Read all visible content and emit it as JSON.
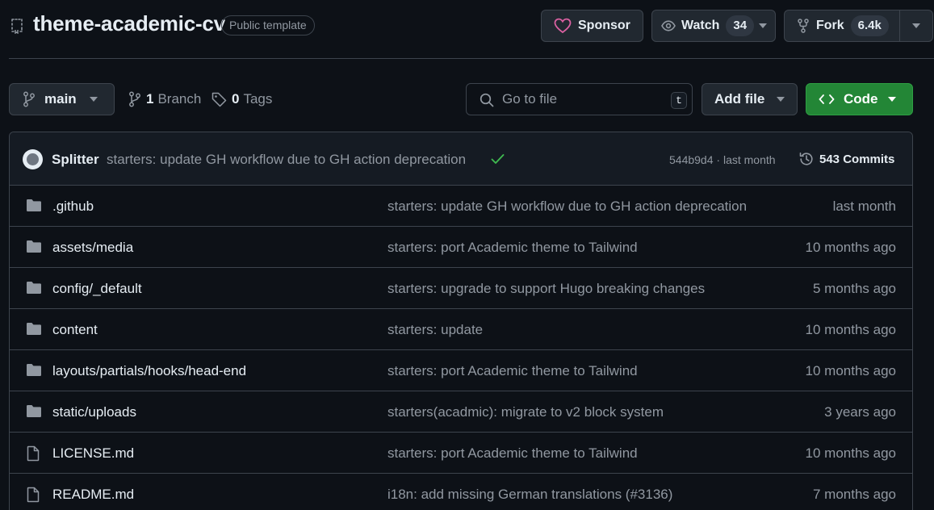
{
  "repo": {
    "name": "theme-academic-cv",
    "visibility": "Public template"
  },
  "actions": {
    "sponsor_label": "Sponsor",
    "watch_label": "Watch",
    "watch_count": "34",
    "fork_label": "Fork",
    "fork_count": "6.4k"
  },
  "toolbar": {
    "branch": "main",
    "branch_count": "1",
    "branch_label": "Branch",
    "tag_count": "0",
    "tag_label": "Tags",
    "goto_placeholder": "Go to file",
    "goto_shortcut": "t",
    "add_file_label": "Add file",
    "code_label": "Code"
  },
  "latest_commit": {
    "author": "Splitter",
    "message": "starters: update GH workflow due to GH action deprecation",
    "sha": "544b9d4",
    "separator": "·",
    "time": "last month",
    "commits_count": "543",
    "commits_label": "Commits"
  },
  "files": [
    {
      "type": "folder",
      "name": ".github",
      "commit": "starters: update GH workflow due to GH action deprecation",
      "age": "last month"
    },
    {
      "type": "folder",
      "name": "assets/media",
      "commit": "starters: port Academic theme to Tailwind",
      "age": "10 months ago"
    },
    {
      "type": "folder",
      "name": "config/_default",
      "commit": "starters: upgrade to support Hugo breaking changes",
      "age": "5 months ago"
    },
    {
      "type": "folder",
      "name": "content",
      "commit": "starters: update",
      "age": "10 months ago"
    },
    {
      "type": "folder",
      "name": "layouts/partials/hooks/head-end",
      "commit": "starters: port Academic theme to Tailwind",
      "age": "10 months ago"
    },
    {
      "type": "folder",
      "name": "static/uploads",
      "commit": "starters(acadmic): migrate to v2 block system",
      "age": "3 years ago"
    },
    {
      "type": "file",
      "name": "LICENSE.md",
      "commit": "starters: port Academic theme to Tailwind",
      "age": "10 months ago"
    },
    {
      "type": "file",
      "name": "README.md",
      "commit": "i18n: add missing German translations (#3136)",
      "age": "7 months ago"
    }
  ],
  "colors": {
    "background": "#0d1117",
    "border": "#3d444d",
    "muted_text": "#9198a1",
    "primary_button": "#238636",
    "sponsor_heart": "#db61a2",
    "success_check": "#3fb950",
    "folder_icon": "#9198a1"
  },
  "icons": {
    "repo": "repo-template-icon",
    "sponsor": "heart-icon",
    "watch": "eye-icon",
    "fork": "repo-forked-icon",
    "branch": "git-branch-icon",
    "tag": "tag-icon",
    "search": "search-icon",
    "code": "code-icon",
    "check": "check-icon",
    "history": "history-icon",
    "folder": "file-directory-icon",
    "file": "file-icon"
  }
}
